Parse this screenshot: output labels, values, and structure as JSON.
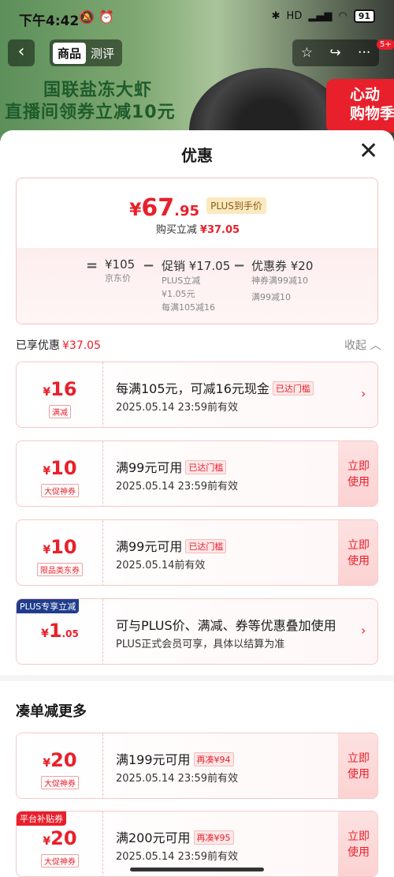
{
  "status_bar": {
    "time": "下午4:42",
    "mute_icon": "🔕",
    "alarm_icon": "⏰",
    "network": "HD",
    "battery": "91"
  },
  "nav": {
    "back": "‹",
    "tabs": [
      "商品",
      "测评"
    ],
    "star": "☆",
    "share": "↪",
    "more": "···",
    "badge": "5+"
  },
  "banner": {
    "line1": "国联盐冻大虾",
    "line2": "直播间领券立减10元",
    "badge": "心动\n购物季"
  },
  "sheet": {
    "title": "优惠",
    "close": "✕"
  },
  "summary": {
    "price": {
      "currency": "¥",
      "integer": "67",
      "decimal": ".95",
      "tag": "PLUS到手价"
    },
    "buy_label": "购买立减",
    "buy_amount": "¥37.05",
    "eq": "=",
    "minus1": "−",
    "minus2": "−",
    "base": {
      "value": "¥105",
      "label": "京东价"
    },
    "promo": {
      "value": "促销 ¥17.05",
      "line1": "PLUS立减",
      "line2": "¥1.05元",
      "line3": "每满105减16"
    },
    "coupon": {
      "value": "优惠券 ¥20",
      "line1": "神券满99减10",
      "line2": "满99减10"
    }
  },
  "enjoyed": {
    "label": "已享优惠",
    "amount": "¥37.05",
    "collapse": "收起 ︿"
  },
  "cards": [
    {
      "currency": "¥",
      "amount": "16",
      "decimal": "",
      "kind": "满减",
      "main": "每满105元，可减16元现金",
      "tag": "已达门槛",
      "valid": "2025.05.14 23:59前有效",
      "action": "›"
    },
    {
      "currency": "¥",
      "amount": "10",
      "decimal": "",
      "kind": "大促神券",
      "main": "满99元可用",
      "tag": "已达门槛",
      "valid": "2025.05.14 23:59前有效",
      "action": "立即\n使用"
    },
    {
      "currency": "¥",
      "amount": "10",
      "decimal": "",
      "kind": "限品类东券",
      "main": "满99元可用",
      "tag": "已达门槛",
      "valid": "2025.05.14前有效",
      "action": "立即\n使用"
    },
    {
      "corner": "PLUS专享立减",
      "currency": "¥",
      "amount": "1",
      "decimal": ".05",
      "main": "可与PLUS价、满减、券等优惠叠加使用",
      "valid": "PLUS正式会员可享，具体以结算为准",
      "action": "›"
    }
  ],
  "more": {
    "title": "凑单减更多",
    "cards": [
      {
        "currency": "¥",
        "amount": "20",
        "kind": "大促神券",
        "main": "满199元可用",
        "tag": "再凑¥94",
        "valid": "2025.05.14 23:59前有效",
        "action": "立即\n使用"
      },
      {
        "corner": "平台补贴券",
        "currency": "¥",
        "amount": "20",
        "kind": "大促神券",
        "main": "满200元可用",
        "tag": "再凑¥95",
        "valid": "2025.05.14 23:59前有效",
        "action": "立即\n使用"
      }
    ]
  },
  "colors": {
    "accent": "#e8202b",
    "plus": "#1f3d8c"
  }
}
